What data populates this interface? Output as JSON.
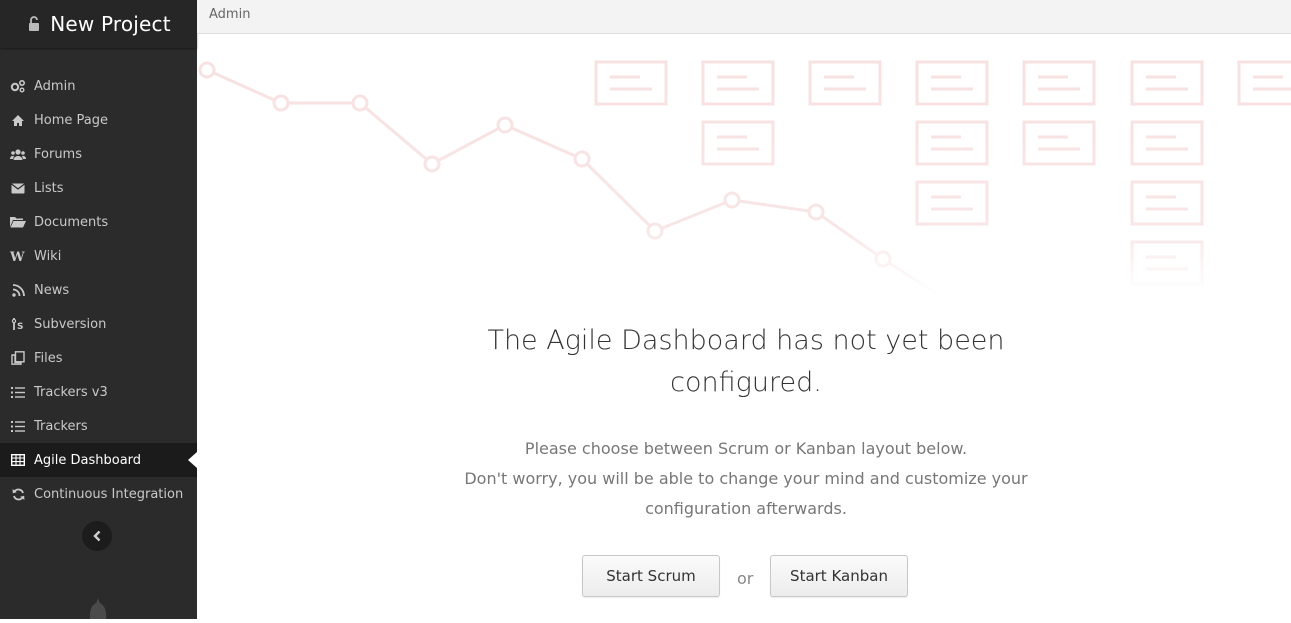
{
  "project": {
    "title": "New Project",
    "icon": "unlock-icon"
  },
  "breadcrumb": {
    "label": "Admin"
  },
  "sidebar": {
    "items": [
      {
        "label": "Admin",
        "icon": "cogs-icon"
      },
      {
        "label": "Home Page",
        "icon": "home-icon"
      },
      {
        "label": "Forums",
        "icon": "users-icon"
      },
      {
        "label": "Lists",
        "icon": "envelope-icon"
      },
      {
        "label": "Documents",
        "icon": "folder-open-icon"
      },
      {
        "label": "Wiki",
        "icon": "wiki-icon"
      },
      {
        "label": "News",
        "icon": "rss-icon"
      },
      {
        "label": "Subversion",
        "icon": "svn-icon"
      },
      {
        "label": "Files",
        "icon": "files-icon"
      },
      {
        "label": "Trackers v3",
        "icon": "list-icon"
      },
      {
        "label": "Trackers",
        "icon": "list-icon"
      },
      {
        "label": "Agile Dashboard",
        "icon": "table-icon",
        "active": true
      },
      {
        "label": "Continuous Integration",
        "icon": "refresh-icon"
      }
    ],
    "collapse_icon": "chevron-left-icon"
  },
  "main": {
    "title": "The Agile Dashboard has not yet been configured.",
    "desc_line1": "Please choose between Scrum or Kanban layout below.",
    "desc_line2": "Don't worry, you will be able to change your mind and customize your configuration afterwards.",
    "scrum_label": "Start Scrum",
    "or_label": "or",
    "kanban_label": "Start Kanban"
  },
  "colors": {
    "sidebar_bg": "#2b2b2b",
    "active_bg": "#1b1b1b",
    "illustration": "#f7e3e3"
  }
}
